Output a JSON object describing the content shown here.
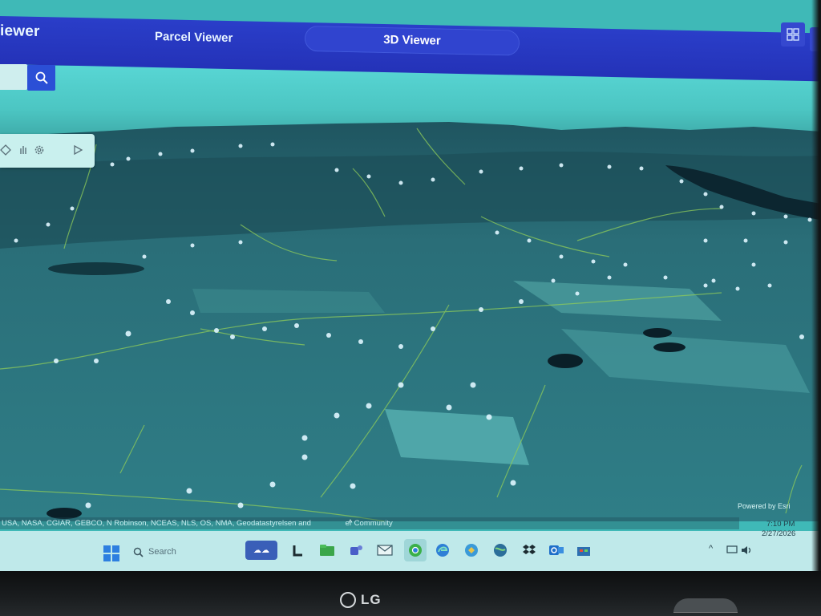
{
  "header": {
    "app_title": "iewer",
    "nav_parcel": "Parcel Viewer",
    "nav_3d": "3D Viewer",
    "accent": "#2a3ec9"
  },
  "search": {
    "value": "",
    "placeholder": "",
    "icon": "search-icon"
  },
  "scene_tools": [
    "navigate-icon",
    "pan-icon",
    "settings-icon",
    "play-icon"
  ],
  "map": {
    "attribution": "USA, NASA, CGIAR, GEBCO, N Robinson, NCEAS, NLS, OS, NMA, Geodatastyrelsen and",
    "attribution_tail": "er Community",
    "powered_by": "Powered by Esri"
  },
  "taskbar": {
    "search_label": "Search",
    "apps": [
      "weather-icon",
      "app-l-icon",
      "file-explorer-icon",
      "teams-icon",
      "mail-icon",
      "chrome-icon",
      "edge-icon",
      "copilot-icon",
      "globe-icon",
      "dropbox-icon",
      "outlook-icon",
      "store-icon"
    ],
    "clock_time": "7:10 PM",
    "clock_date": "2/27/2026"
  },
  "monitor": {
    "brand": "LG"
  }
}
